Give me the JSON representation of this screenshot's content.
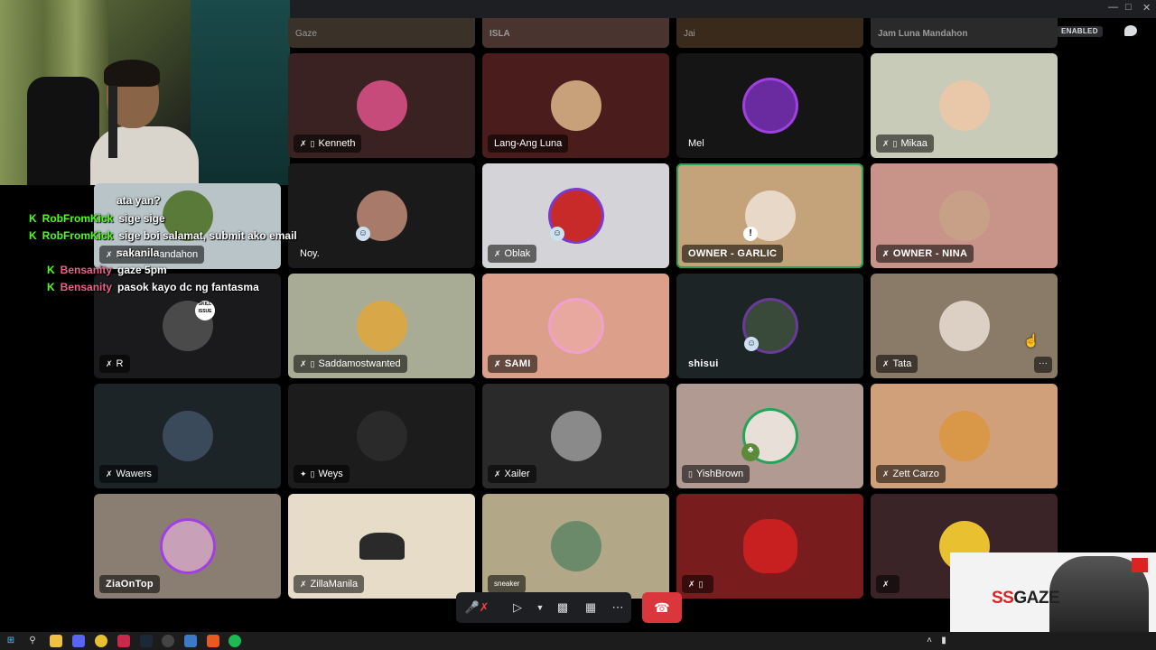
{
  "window": {
    "enabled_badge": "ENABLED"
  },
  "top_row": [
    {
      "name": "Gaze"
    },
    {
      "name": "ISLA"
    },
    {
      "name": "Jai"
    },
    {
      "name": "Jam Luna Mandahon"
    }
  ],
  "tiles": [
    {
      "name": "Kenneth",
      "bg": "#3a2222",
      "avatar_color": "#c64a7a",
      "icon": "mute-deafen"
    },
    {
      "name": "Lang-Ang Luna",
      "bg": "#4a1c1c",
      "avatar_color": "#c8a07a",
      "icon": ""
    },
    {
      "name": "Mel",
      "bg": "#151515",
      "avatar_color": "#6a2aa0",
      "icon": ""
    },
    {
      "name": "Mikaa",
      "bg": "#c8cbb8",
      "avatar_color": "#e8c8a8",
      "icon": "mute-mobile"
    },
    {
      "name": "Nathan Mandahon",
      "bg": "#b8c4c8",
      "avatar_color": "#5a7a3a",
      "icon": "mute"
    },
    {
      "name": "Noy.",
      "bg": "#1a1a1a",
      "avatar_color": "#a87a6a",
      "icon": ""
    },
    {
      "name": "Oblak",
      "bg": "#d4d4d8",
      "avatar_color": "#c82a2a",
      "icon": "mute"
    },
    {
      "name": "OWNER - GARLIC",
      "bg": "#c4a27a",
      "avatar_color": "#e8d8c8",
      "icon": "",
      "speaking": true
    },
    {
      "name": "OWNER - NINA",
      "bg": "#c8948a",
      "avatar_color": "#c8a088",
      "icon": "mute"
    },
    {
      "name": "R",
      "bg": "#1a1a1c",
      "avatar_color": "#4a4a4a",
      "icon": "mute"
    },
    {
      "name": "Saddamostwanted",
      "bg": "#a8ac94",
      "avatar_color": "#d8a848",
      "icon": "mute-mobile"
    },
    {
      "name": "SAMI",
      "bg": "#dca08a",
      "avatar_color": "#e8a8a0",
      "icon": "mute"
    },
    {
      "name": "shisui",
      "bg": "#1c2426",
      "avatar_color": "#3a4a3a",
      "icon": ""
    },
    {
      "name": "Tata",
      "bg": "#8a7a68",
      "avatar_color": "#dcd0c4",
      "icon": "mute"
    },
    {
      "name": "Wawers",
      "bg": "#1c2428",
      "avatar_color": "#3a4a5a",
      "icon": "mute"
    },
    {
      "name": "Weys",
      "bg": "#1c1c1c",
      "avatar_color": "#2a2a2a",
      "icon": "stream-mobile"
    },
    {
      "name": "Xailer",
      "bg": "#2a2a2a",
      "avatar_color": "#8a8a8a",
      "icon": "mute"
    },
    {
      "name": "YishBrown",
      "bg": "#b09a92",
      "avatar_color": "#e8e0d8",
      "icon": "mobile"
    },
    {
      "name": "Zett Carzo",
      "bg": "#d0a07a",
      "avatar_color": "#d89848",
      "icon": "mute"
    },
    {
      "name": "ZiaOnTop",
      "bg": "#8a7e72",
      "avatar_color": "#c8a0b8",
      "icon": ""
    },
    {
      "name": "ZillaManila",
      "bg": "#e6dcc8",
      "avatar_color": "#2a2a2a",
      "icon": "mute"
    },
    {
      "name": "sneaker",
      "bg": "#b2a888",
      "avatar_color": "#6a8a6a",
      "icon": ""
    },
    {
      "name": "",
      "bg": "#781c1e",
      "avatar_color": "#c82020",
      "icon": "mute-mobile"
    },
    {
      "name": "",
      "bg": "#3a2428",
      "avatar_color": "#e8c030",
      "icon": "mute"
    }
  ],
  "chat": [
    {
      "user": "",
      "msg": "ata yan?"
    },
    {
      "user": "RobFromKick",
      "msg": "sige sige",
      "color": "green"
    },
    {
      "user": "RobFromKick",
      "msg": "sige boi salamat, submit ako email",
      "color": "green"
    },
    {
      "user": "",
      "msg": "sakanila"
    },
    {
      "user": "Bensanity",
      "msg": "gaze 5pm",
      "color": "pink"
    },
    {
      "user": "Bensanity",
      "msg": "pasok kayo dc ng fantasma",
      "color": "pink"
    }
  ],
  "overlay": {
    "brand_ss": "SS",
    "brand_name": "GAZE"
  },
  "callbar": {
    "mute_icon": "mic-muted-icon",
    "camera_icon": "camera-off-icon",
    "share_icon": "screen-share-icon",
    "activity_icon": "activity-icon",
    "more_icon": "more-icon",
    "end_icon": "end-call-icon"
  },
  "tata_more": "···",
  "skill_issue": "SKILL ISSUE"
}
